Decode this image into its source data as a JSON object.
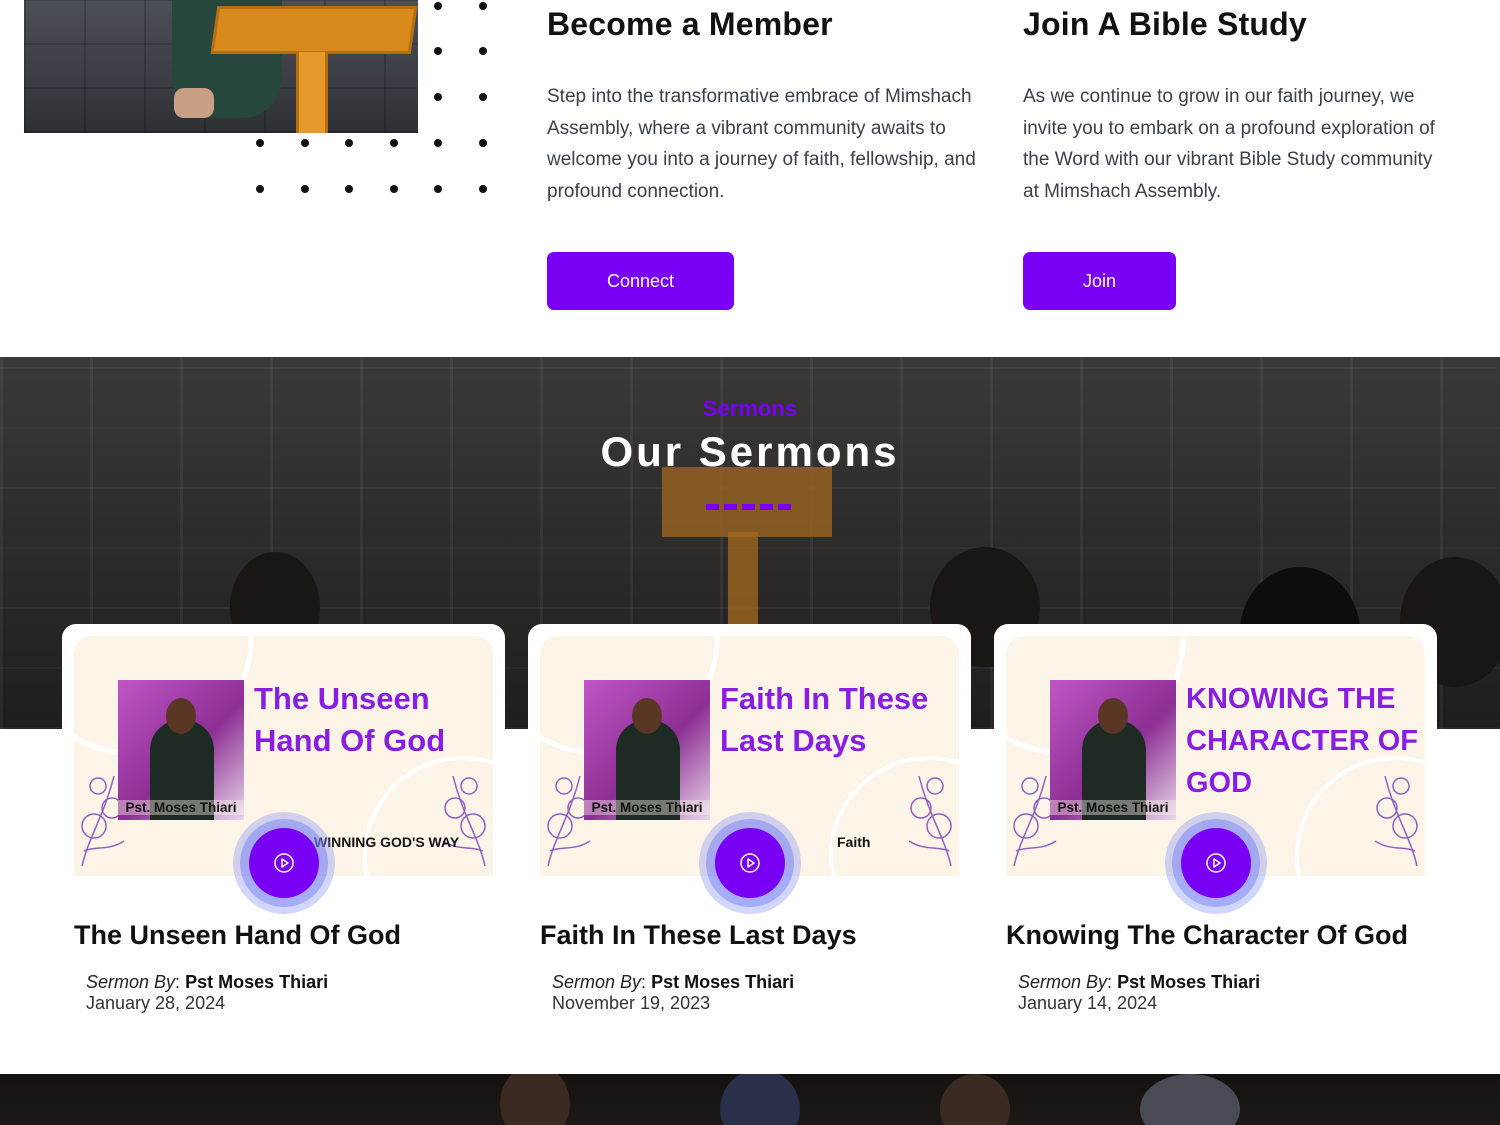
{
  "colors": {
    "accent": "#7a00f5",
    "thumb_title": "#8a1ee0",
    "thumb_bg": "#fdf4e8"
  },
  "member": {
    "title": "Become a Member",
    "text": "Step into the transformative embrace of Mimshach Assembly, where a vibrant community awaits to welcome you into a journey of faith, fellowship, and profound connection.",
    "button": "Connect"
  },
  "bible": {
    "title": "Join A Bible Study",
    "text": "As we continue to grow in our faith journey, we invite you to embark on a profound exploration of the Word with our vibrant Bible Study community at Mimshach Assembly.",
    "button": "Join"
  },
  "sermons": {
    "eyebrow": "Sermons",
    "heading": "Our Sermons",
    "cards": [
      {
        "thumb_title_lines": [
          "The Unseen",
          "Hand Of God"
        ],
        "thumb_name": "Pst. Moses Thiari",
        "thumb_subtitle": "WINNING GOD'S WAY",
        "title": "The Unseen Hand Of God",
        "by_label": "Sermon By",
        "by_name": "Pst Moses Thiari",
        "date": "January 28, 2024",
        "play_icon": "play-circle-icon"
      },
      {
        "thumb_title_lines": [
          "Faith In These",
          "Last Days"
        ],
        "thumb_name": "Pst. Moses Thiari",
        "thumb_subtitle": "Faith",
        "title": "Faith In These Last Days",
        "by_label": "Sermon By",
        "by_name": "Pst Moses Thiari",
        "date": "November 19, 2023",
        "play_icon": "play-circle-icon"
      },
      {
        "thumb_title_lines": [
          "KNOWING THE",
          "CHARACTER OF",
          "GOD"
        ],
        "thumb_name": "Pst. Moses Thiari",
        "thumb_subtitle": "",
        "title": "Knowing The Character Of God",
        "by_label": "Sermon By",
        "by_name": "Pst Moses Thiari",
        "date": "January 14, 2024",
        "play_icon": "play-circle-icon"
      }
    ]
  }
}
